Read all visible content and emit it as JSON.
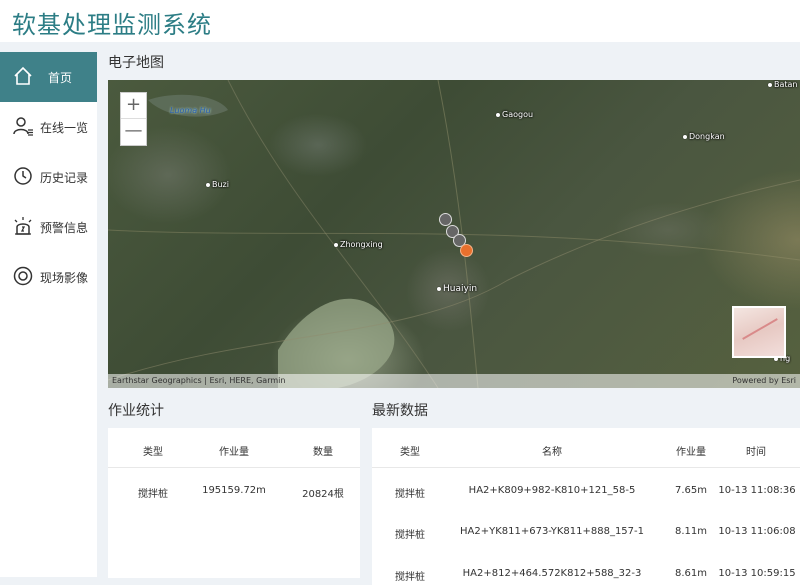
{
  "app": {
    "title": "软基处理监测系统"
  },
  "nav": [
    {
      "label": "首页",
      "icon": "home-icon",
      "active": true
    },
    {
      "label": "在线一览",
      "icon": "user-list-icon",
      "active": false
    },
    {
      "label": "历史记录",
      "icon": "clock-icon",
      "active": false
    },
    {
      "label": "预警信息",
      "icon": "alarm-icon",
      "active": false
    },
    {
      "label": "现场影像",
      "icon": "camera-icon",
      "active": false
    }
  ],
  "map": {
    "title": "电子地图",
    "zoom_in": "+",
    "zoom_out": "—",
    "places": [
      "Luoma Hu",
      "Gaogou",
      "Dongkan",
      "Batan",
      "Buzi",
      "Zhongxing",
      "Huaiyin",
      "ng"
    ],
    "attribution_left": "Earthstar Geographics | Esri, HERE, Garmin",
    "attribution_right": "Powered by Esri",
    "marker_colors": {
      "normal": "#666666",
      "latest": "#e8702d"
    }
  },
  "stats": {
    "title": "作业统计",
    "headers": [
      "类型",
      "作业量",
      "数量"
    ],
    "rows": [
      [
        "搅拌桩",
        "195159.72m",
        "20824根"
      ]
    ]
  },
  "latest": {
    "title": "最新数据",
    "headers": [
      "类型",
      "名称",
      "作业量",
      "时间"
    ],
    "rows": [
      [
        "搅拌桩",
        "HA2+K809+982-K810+121_58-5",
        "7.65m",
        "10-13 11:08:36"
      ],
      [
        "搅拌桩",
        "HA2+YK811+673-YK811+888_157-1",
        "8.11m",
        "10-13 11:06:08"
      ],
      [
        "搅拌桩",
        "HA2+812+464.572K812+588_32-3",
        "8.61m",
        "10-13 10:59:15"
      ]
    ]
  },
  "colors": {
    "accent": "#3f8189",
    "title": "#2c7d85",
    "background": "#eef2f6"
  }
}
